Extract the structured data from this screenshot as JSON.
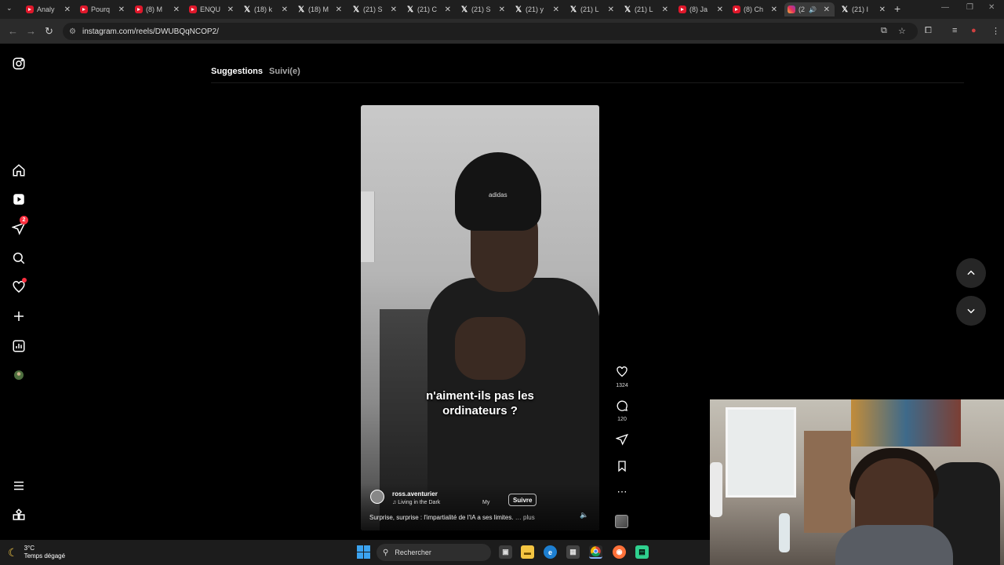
{
  "browser": {
    "tabs": [
      {
        "label": "Analy",
        "icon": "youtube"
      },
      {
        "label": "Pourq",
        "icon": "youtube"
      },
      {
        "label": "(8) M",
        "icon": "youtube"
      },
      {
        "label": "ENQU",
        "icon": "youtube"
      },
      {
        "label": "(18) k",
        "icon": "x"
      },
      {
        "label": "(18) M",
        "icon": "x"
      },
      {
        "label": "(21) S",
        "icon": "x"
      },
      {
        "label": "(21) C",
        "icon": "x"
      },
      {
        "label": "(21) S",
        "icon": "x"
      },
      {
        "label": "(21) y",
        "icon": "x"
      },
      {
        "label": "(21) L",
        "icon": "x"
      },
      {
        "label": "(21) L",
        "icon": "x"
      },
      {
        "label": "(8) Ja",
        "icon": "youtube"
      },
      {
        "label": "(8) Ch",
        "icon": "youtube"
      },
      {
        "label": "(2",
        "icon": "instagram",
        "active": true
      },
      {
        "label": "(21) I",
        "icon": "x"
      }
    ],
    "new_tab": "+",
    "url": "instagram.com/reels/DWUBQqNCOP2/"
  },
  "instagram": {
    "sidebar": {
      "notifications_badge": "2"
    },
    "feed_tabs": {
      "suggestions": "Suggestions",
      "following": "Suivi(e)"
    },
    "reel": {
      "overlay_caption_line1": "n'aiment-ils pas les",
      "overlay_caption_line2": "ordinateurs ?",
      "beanie_logo": "adidas",
      "author": "ross.aventurier",
      "music": "Living in the Dark",
      "music_secondary": "My",
      "follow_label": "Suivre",
      "description": "Surprise, surprise : l'impartialité de l'IA a ses limites.",
      "more_label": "… plus",
      "likes": "1324",
      "comments": "120"
    }
  },
  "taskbar": {
    "weather_temp": "3°C",
    "weather_desc": "Temps dégagé",
    "search_placeholder": "Rechercher"
  },
  "colors": {
    "accent_red": "#ff3040",
    "background": "#000000",
    "windows_blue": "#3ba3f0"
  }
}
